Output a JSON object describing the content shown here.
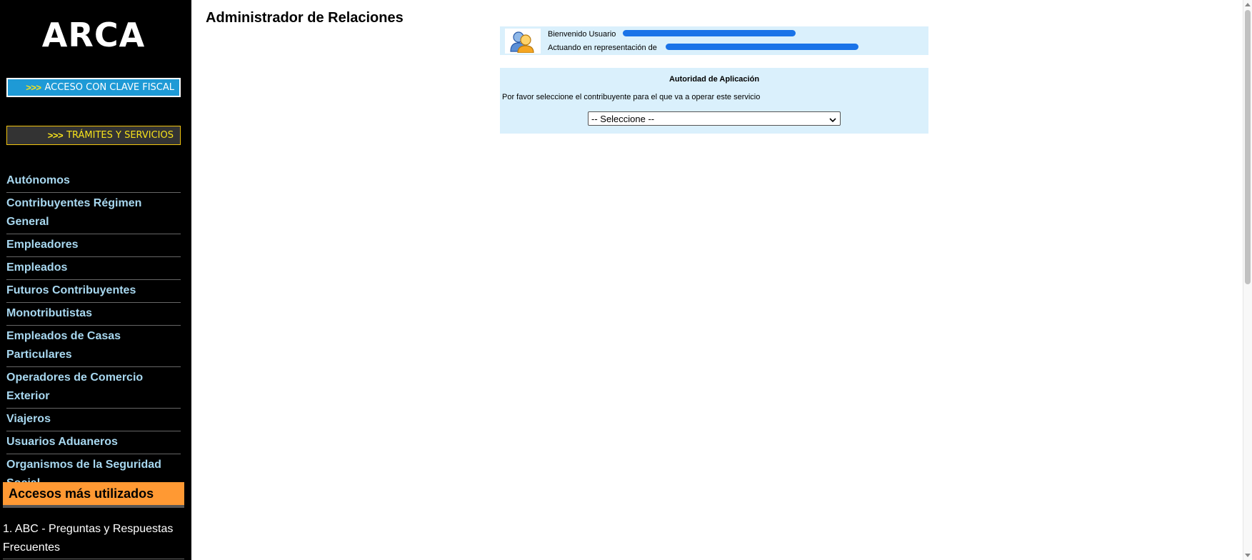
{
  "sidebar": {
    "logo": "ARCA",
    "btn_clave": {
      "arrows": ">>>",
      "label": "ACCESO CON CLAVE FISCAL"
    },
    "btn_tramites": {
      "arrows": ">>>",
      "label": "TRÁMITES Y SERVICIOS"
    },
    "nav": [
      {
        "label": "Autónomos"
      },
      {
        "label": "Contribuyentes Régimen General"
      },
      {
        "label": "Empleadores"
      },
      {
        "label": "Empleados"
      },
      {
        "label": "Futuros Contribuyentes"
      },
      {
        "label": "Monotributistas"
      },
      {
        "label": "Empleados de Casas Particulares"
      },
      {
        "label": "Operadores de Comercio Exterior"
      },
      {
        "label": "Viajeros"
      },
      {
        "label": "Usuarios Aduaneros"
      },
      {
        "label": "Organismos de la Seguridad Social"
      }
    ],
    "frequent_title": "Accesos más utilizados",
    "frequent_items": [
      {
        "label": "1. ABC - Preguntas y Respuestas Frecuentes"
      }
    ]
  },
  "main": {
    "title": "Administrador de Relaciones",
    "user": {
      "welcome_label": "Bienvenido Usuario",
      "representing_label": "Actuando en representación de"
    },
    "auth": {
      "title": "Autoridad de Aplicación",
      "prompt": "Por favor seleccione el contribuyente para el que va a operar este servicio",
      "select_value": "-- Seleccione --"
    }
  },
  "colors": {
    "sidebar_bg": "#000000",
    "nav_text": "#a8d8f0",
    "clave_button": "#1e9ad6",
    "frequent_header": "#ff9933",
    "panel_bg": "#daf0fc",
    "redaction": "#1a73e8"
  },
  "icons": {
    "avatar": "users-icon",
    "select_caret": "chevron-down-icon"
  }
}
